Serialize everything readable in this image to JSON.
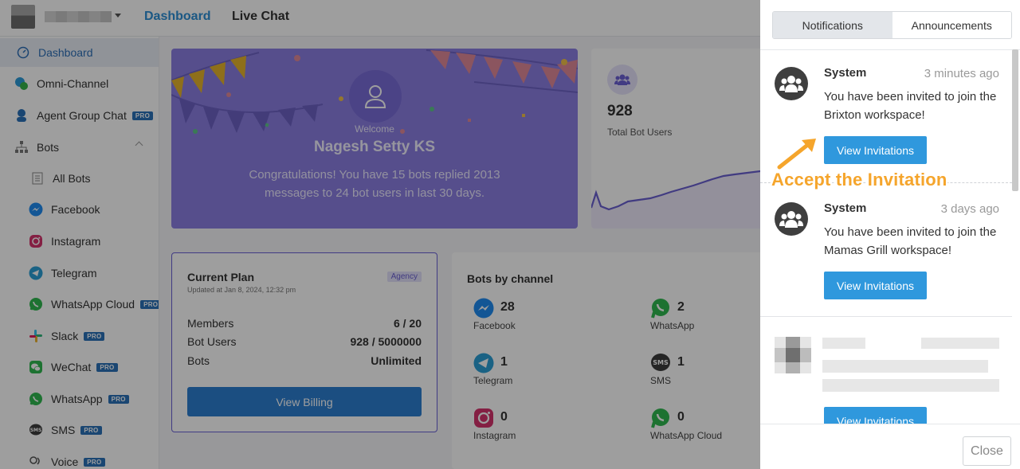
{
  "topbar": {
    "nav_dashboard": "Dashboard",
    "nav_live_chat": "Live Chat"
  },
  "sidebar": {
    "items": [
      {
        "label": "Dashboard",
        "icon": "dashboard-icon",
        "pro": ""
      },
      {
        "label": "Omni-Channel",
        "icon": "omni-channel-icon",
        "pro": ""
      },
      {
        "label": "Agent Group Chat",
        "icon": "agent-icon",
        "pro": "PRO"
      },
      {
        "label": "Bots",
        "icon": "bots-icon",
        "pro": ""
      },
      {
        "label": "All Bots",
        "icon": "all-bots-icon",
        "pro": ""
      },
      {
        "label": "Facebook",
        "icon": "messenger-icon",
        "pro": ""
      },
      {
        "label": "Instagram",
        "icon": "instagram-icon",
        "pro": ""
      },
      {
        "label": "Telegram",
        "icon": "telegram-icon",
        "pro": ""
      },
      {
        "label": "WhatsApp Cloud",
        "icon": "whatsapp-icon",
        "pro": "PRO"
      },
      {
        "label": "Slack",
        "icon": "slack-icon",
        "pro": "PRO"
      },
      {
        "label": "WeChat",
        "icon": "wechat-icon",
        "pro": "PRO"
      },
      {
        "label": "WhatsApp",
        "icon": "whatsapp-icon",
        "pro": "PRO"
      },
      {
        "label": "SMS",
        "icon": "sms-icon",
        "pro": "PRO"
      },
      {
        "label": "Voice",
        "icon": "voice-icon",
        "pro": "PRO"
      }
    ]
  },
  "welcome": {
    "greeting": "Welcome",
    "name": "Nagesh Setty KS",
    "message": "Congratulations! You have 15 bots replied 2013 messages to 24 bot users in last 30 days."
  },
  "bot_users": {
    "count": "928",
    "label": "Total Bot Users"
  },
  "plan": {
    "title": "Current Plan",
    "updated": "Updated at Jan 8, 2024, 12:32 pm",
    "badge": "Agency",
    "rows": [
      {
        "label": "Members",
        "value": "6 / 20"
      },
      {
        "label": "Bot Users",
        "value": "928 / 5000000"
      },
      {
        "label": "Bots",
        "value": "Unlimited"
      }
    ],
    "billing_button": "View Billing"
  },
  "channels": {
    "title": "Bots by channel",
    "items": [
      {
        "name": "Facebook",
        "count": "28",
        "icon": "messenger-icon"
      },
      {
        "name": "WhatsApp",
        "count": "2",
        "icon": "whatsapp-icon"
      },
      {
        "name": "Telegram",
        "count": "1",
        "icon": "telegram-icon"
      },
      {
        "name": "SMS",
        "count": "1",
        "icon": "sms-icon"
      },
      {
        "name": "Instagram",
        "count": "0",
        "icon": "instagram-icon"
      },
      {
        "name": "WhatsApp Cloud",
        "count": "0",
        "icon": "whatsapp-icon"
      }
    ]
  },
  "panel": {
    "tabs": [
      "Notifications",
      "Announcements"
    ],
    "notifications": [
      {
        "sender": "System",
        "time": "3 minutes ago",
        "text": "You have been invited to join the Brixton workspace!",
        "button": "View Invitations"
      },
      {
        "sender": "System",
        "time": "3 days ago",
        "text": "You have been invited to join the Mamas Grill workspace!",
        "button": "View Invitations"
      },
      {
        "sender": "",
        "time": "",
        "text": "",
        "button": "View Invitations"
      }
    ],
    "close_button": "Close"
  },
  "annotation": {
    "text": "Accept the Invitation"
  },
  "colors": {
    "accent": "#2d8fd5",
    "welcome_bg": "#8b7fe2",
    "notif_button": "#2f98dd",
    "annotation": "#f5a52c"
  }
}
